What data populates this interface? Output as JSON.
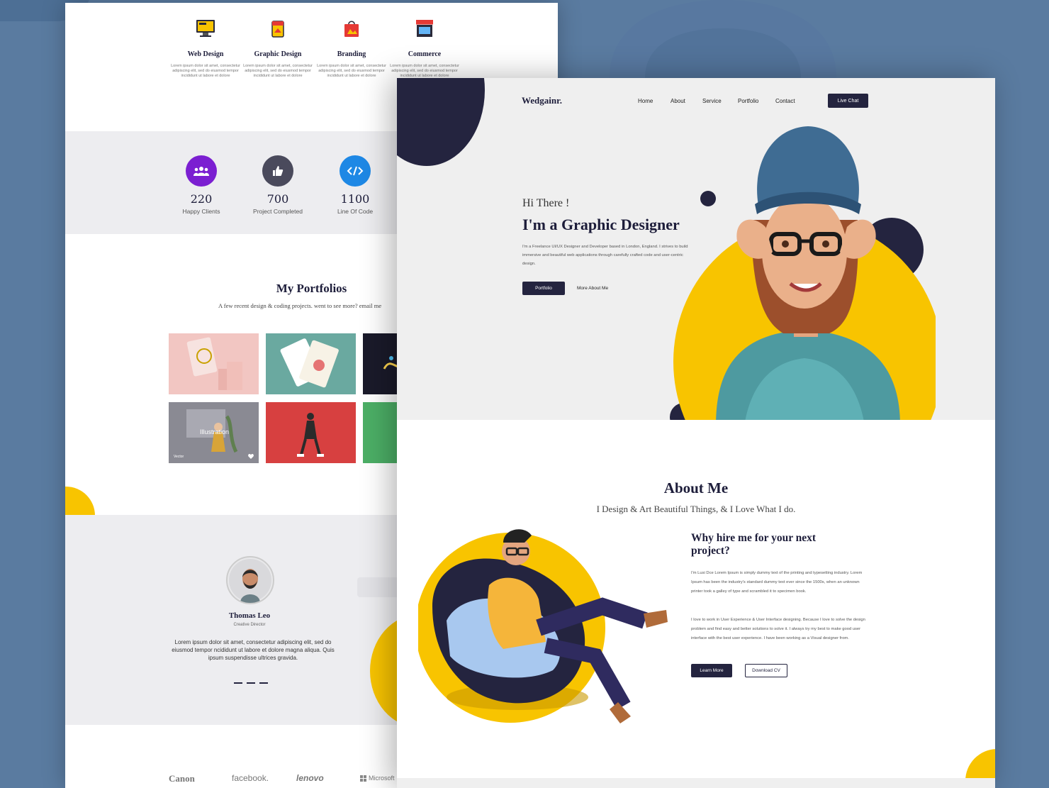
{
  "back_page": {
    "services": [
      {
        "title": "Web Design",
        "desc": "Lorem ipsum dolor sit amet, consectetur adipiscing elit, sed do eiusmod tempor incididunt ut labore et dolore"
      },
      {
        "title": "Graphic Design",
        "desc": "Lorem ipsum dolor sit amet, consectetur adipiscing elit, sed do eiusmod tempor incididunt ut labore et dolore"
      },
      {
        "title": "Branding",
        "desc": "Lorem ipsum dolor sit amet, consectetur adipiscing elit, sed do eiusmod tempor incididunt ut labore et dolore"
      },
      {
        "title": "Commerce",
        "desc": "Lorem ipsum dolor sit amet, consectetur adipiscing elit, sed do eiusmod tempor incididunt ut labore et dolore"
      }
    ],
    "stats": [
      {
        "number": "220",
        "label": "Happy Clients",
        "icon": "users-icon",
        "color": "#7b1fd1"
      },
      {
        "number": "700",
        "label": "Project Completed",
        "icon": "thumbs-up-icon",
        "color": "#4a4a5c"
      },
      {
        "number": "1100",
        "label": "Line Of Code",
        "icon": "code-icon",
        "color": "#1e88e5"
      }
    ],
    "portfolio": {
      "title": "My Portfolios",
      "subtitle": "A few recent design & coding projects. went to see more? email me",
      "overlay_title": "Illustration",
      "overlay_tag": "Vector"
    },
    "testimonial": {
      "name": "Thomas Leo",
      "role": "Creative Director",
      "quote": "Lorem ipsum dolor sit amet, consectetur adipiscing elit, sed do eiusmod tempor ncididunt ut labore et dolore magna aliqua. Quis ipsum suspendisse ultrices gravida."
    },
    "logos": [
      "Canon",
      "facebook.",
      "lenovo",
      "Microsoft"
    ]
  },
  "front_page": {
    "brand": "Wedgainr.",
    "nav": [
      "Home",
      "About",
      "Service",
      "Portfolio",
      "Contact"
    ],
    "live_chat": "Live Chat",
    "hero": {
      "greeting": "Hi There !",
      "headline": "I'm a Graphic Designer",
      "description": "I'm a Freelance UI/UX Designer and Developer based in London, England. I strives to build immersive and beautiful web applications through carefully crafted code and user-centric design.",
      "primary_button": "Portfolio",
      "secondary_link": "More About Me"
    },
    "about": {
      "title": "About Me",
      "subtitle": "I Design & Art Beautiful Things, & I Love What I do.",
      "why_title": "Why hire me for your next project?",
      "paragraph1": "I'm Lusi Dce Lorem Ipsum is simply dummy text of the printing and typesetting industry. Lorem Ipsum has been the industry's standard dummy text ever since the 1500s, when an unknown printer took a galley of type and scrambled it to specimen book.",
      "paragraph2": "I love to work in User Experience & User Interface designing. Because I love to solve the design problem and find easy and better solutions to solve it. I always try my best to make good user interface with the best user experience. I have been working as a Visual designer from.",
      "learn_more": "Learn More",
      "download_cv": "Download CV"
    }
  },
  "colors": {
    "accent_dark": "#24243f",
    "yellow": "#f8c400",
    "background": "#5a7ba0"
  }
}
